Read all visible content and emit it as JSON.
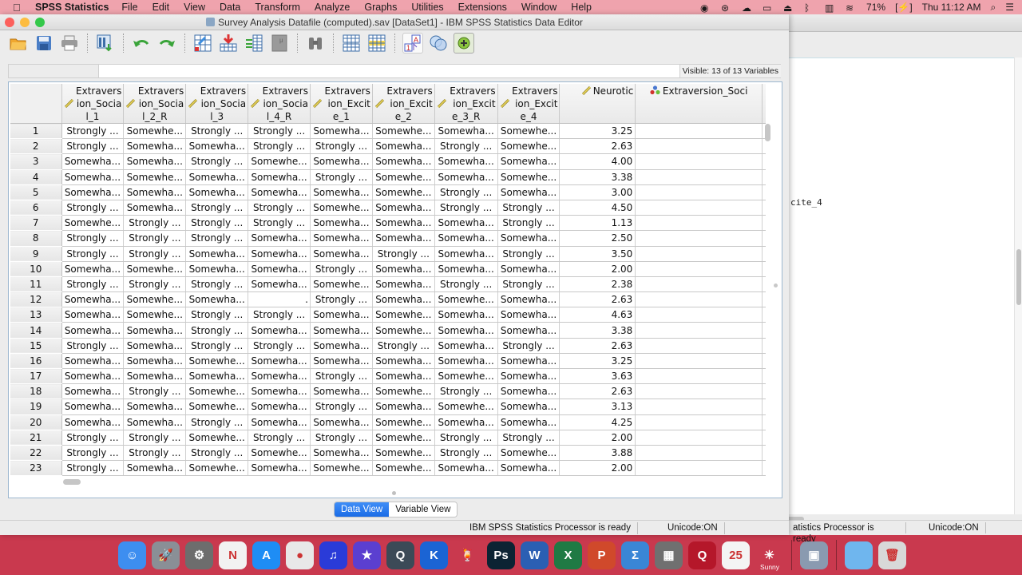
{
  "menubar": {
    "app_name": "SPSS Statistics",
    "items": [
      "File",
      "Edit",
      "View",
      "Data",
      "Transform",
      "Analyze",
      "Graphs",
      "Utilities",
      "Extensions",
      "Window",
      "Help"
    ],
    "battery": "71%",
    "clock": "Thu 11:12 AM"
  },
  "window": {
    "title": "Survey Analysis Datafile (computed).sav [DataSet1] - IBM SPSS Statistics Data Editor"
  },
  "toolbar": {
    "buttons": [
      "open-data",
      "save",
      "print",
      "recall-dialog",
      "undo",
      "redo",
      "go-to-case",
      "go-to-variable",
      "variables",
      "run-descriptive",
      "find",
      "insert-cases",
      "split-file",
      "value-labels",
      "use-variable-sets",
      "show-all-variables",
      "spelling"
    ]
  },
  "cellbar": {
    "visible_count": "Visible: 13 of 13 Variables"
  },
  "grid": {
    "columns": [
      {
        "lines": [
          "Extravers",
          "ion_Socia",
          "l_1"
        ],
        "type": "scale"
      },
      {
        "lines": [
          "Extravers",
          "ion_Socia",
          "l_2_R"
        ],
        "type": "scale"
      },
      {
        "lines": [
          "Extravers",
          "ion_Socia",
          "l_3"
        ],
        "type": "scale"
      },
      {
        "lines": [
          "Extravers",
          "ion_Socia",
          "l_4_R"
        ],
        "type": "scale"
      },
      {
        "lines": [
          "Extravers",
          "ion_Excit",
          "e_1"
        ],
        "type": "scale"
      },
      {
        "lines": [
          "Extravers",
          "ion_Excit",
          "e_2"
        ],
        "type": "scale"
      },
      {
        "lines": [
          "Extravers",
          "ion_Excit",
          "e_3_R"
        ],
        "type": "scale"
      },
      {
        "lines": [
          "Extravers",
          "ion_Excit",
          "e_4"
        ],
        "type": "scale"
      },
      {
        "lines": [
          "Neurotic"
        ],
        "type": "scale"
      },
      {
        "lines": [
          "Extraversion_Soci"
        ],
        "type": "nominal"
      }
    ],
    "rows": [
      {
        "n": "1",
        "c": [
          "Strongly ...",
          "Somewhe...",
          "Strongly ...",
          "Strongly ...",
          "Somewha...",
          "Somewhe...",
          "Somewha...",
          "Somewhe...",
          "3.25",
          ""
        ]
      },
      {
        "n": "2",
        "c": [
          "Strongly ...",
          "Somewha...",
          "Somewha...",
          "Strongly ...",
          "Strongly ...",
          "Somewha...",
          "Strongly ...",
          "Somewhe...",
          "2.63",
          ""
        ]
      },
      {
        "n": "3",
        "c": [
          "Somewha...",
          "Somewha...",
          "Strongly ...",
          "Somewhe...",
          "Somewha...",
          "Somewha...",
          "Somewha...",
          "Somewha...",
          "4.00",
          ""
        ]
      },
      {
        "n": "4",
        "c": [
          "Somewha...",
          "Somewhe...",
          "Somewha...",
          "Somewha...",
          "Strongly ...",
          "Somewhe...",
          "Somewha...",
          "Somewhe...",
          "3.38",
          ""
        ]
      },
      {
        "n": "5",
        "c": [
          "Somewha...",
          "Somewha...",
          "Somewha...",
          "Somewha...",
          "Somewha...",
          "Somewhe...",
          "Strongly ...",
          "Somewha...",
          "3.00",
          ""
        ]
      },
      {
        "n": "6",
        "c": [
          "Strongly ...",
          "Somewha...",
          "Strongly ...",
          "Strongly ...",
          "Somewhe...",
          "Somewha...",
          "Strongly ...",
          "Strongly ...",
          "4.50",
          ""
        ]
      },
      {
        "n": "7",
        "c": [
          "Somewhe...",
          "Strongly ...",
          "Strongly ...",
          "Strongly ...",
          "Somewha...",
          "Somewha...",
          "Somewha...",
          "Strongly ...",
          "1.13",
          ""
        ]
      },
      {
        "n": "8",
        "c": [
          "Strongly ...",
          "Strongly ...",
          "Strongly ...",
          "Somewha...",
          "Somewha...",
          "Somewha...",
          "Somewha...",
          "Somewha...",
          "2.50",
          ""
        ]
      },
      {
        "n": "9",
        "c": [
          "Strongly ...",
          "Strongly ...",
          "Somewha...",
          "Somewha...",
          "Somewha...",
          "Strongly ...",
          "Somewha...",
          "Strongly ...",
          "3.50",
          ""
        ]
      },
      {
        "n": "10",
        "c": [
          "Somewha...",
          "Somewhe...",
          "Somewha...",
          "Somewha...",
          "Strongly ...",
          "Somewha...",
          "Somewha...",
          "Somewha...",
          "2.00",
          ""
        ]
      },
      {
        "n": "11",
        "c": [
          "Strongly ...",
          "Strongly ...",
          "Strongly ...",
          "Somewha...",
          "Somewhe...",
          "Somewha...",
          "Strongly ...",
          "Strongly ...",
          "2.38",
          ""
        ]
      },
      {
        "n": "12",
        "c": [
          "Somewha...",
          "Somewhe...",
          "Somewha...",
          ".",
          "Strongly ...",
          "Somewha...",
          "Somewhe...",
          "Somewha...",
          "2.63",
          ""
        ]
      },
      {
        "n": "13",
        "c": [
          "Somewha...",
          "Somewhe...",
          "Strongly ...",
          "Strongly ...",
          "Somewha...",
          "Somewhe...",
          "Somewha...",
          "Somewha...",
          "4.63",
          ""
        ]
      },
      {
        "n": "14",
        "c": [
          "Somewha...",
          "Somewha...",
          "Strongly ...",
          "Somewha...",
          "Somewha...",
          "Somewhe...",
          "Somewha...",
          "Somewha...",
          "3.38",
          ""
        ]
      },
      {
        "n": "15",
        "c": [
          "Strongly ...",
          "Somewha...",
          "Strongly ...",
          "Strongly ...",
          "Somewha...",
          "Strongly ...",
          "Somewha...",
          "Strongly ...",
          "2.63",
          ""
        ]
      },
      {
        "n": "16",
        "c": [
          "Somewha...",
          "Somewha...",
          "Somewhe...",
          "Somewha...",
          "Somewha...",
          "Somewha...",
          "Somewha...",
          "Somewha...",
          "3.25",
          ""
        ]
      },
      {
        "n": "17",
        "c": [
          "Somewha...",
          "Somewha...",
          "Somewha...",
          "Somewha...",
          "Strongly ...",
          "Somewha...",
          "Somewhe...",
          "Somewha...",
          "3.63",
          ""
        ]
      },
      {
        "n": "18",
        "c": [
          "Somewha...",
          "Strongly ...",
          "Somewhe...",
          "Somewha...",
          "Somewha...",
          "Somewhe...",
          "Strongly ...",
          "Somewha...",
          "2.63",
          ""
        ]
      },
      {
        "n": "19",
        "c": [
          "Somewha...",
          "Somewha...",
          "Somewhe...",
          "Somewha...",
          "Strongly ...",
          "Somewha...",
          "Somewhe...",
          "Somewha...",
          "3.13",
          ""
        ]
      },
      {
        "n": "20",
        "c": [
          "Somewha...",
          "Somewha...",
          "Strongly ...",
          "Somewha...",
          "Somewha...",
          "Somewhe...",
          "Somewha...",
          "Somewha...",
          "4.25",
          ""
        ]
      },
      {
        "n": "21",
        "c": [
          "Strongly ...",
          "Strongly ...",
          "Somewhe...",
          "Strongly ...",
          "Strongly ...",
          "Somewhe...",
          "Strongly ...",
          "Strongly ...",
          "2.00",
          ""
        ]
      },
      {
        "n": "22",
        "c": [
          "Strongly ...",
          "Strongly ...",
          "Strongly ...",
          "Somewhe...",
          "Somewha...",
          "Somewhe...",
          "Strongly ...",
          "Somewhe...",
          "3.88",
          ""
        ]
      },
      {
        "n": "23",
        "c": [
          "Strongly ...",
          "Somewha...",
          "Somewhe...",
          "Somewha...",
          "Somewhe...",
          "Somewhe...",
          "Somewha...",
          "Somewha...",
          "2.00",
          ""
        ]
      }
    ]
  },
  "tabs": {
    "data_view": "Data View",
    "variable_view": "Variable View",
    "active": "data_view"
  },
  "status": {
    "processor": "IBM SPSS Statistics Processor is ready",
    "unicode": "Unicode:ON"
  },
  "background_window": {
    "partial_text": "cite_4",
    "status_processor": "atistics Processor is ready",
    "status_unicode": "Unicode:ON"
  },
  "dock": {
    "apps": [
      {
        "name": "finder",
        "label": "☺",
        "color": "#3d8ef0"
      },
      {
        "name": "launchpad",
        "label": "🚀",
        "color": "#8a8f96"
      },
      {
        "name": "system-preferences",
        "label": "⚙",
        "color": "#6d6d6d"
      },
      {
        "name": "news",
        "label": "N",
        "color": "#f2f2f2"
      },
      {
        "name": "app-store",
        "label": "A",
        "color": "#1e8df5"
      },
      {
        "name": "chrome",
        "label": "●",
        "color": "#e8e8e8"
      },
      {
        "name": "audacity",
        "label": "♫",
        "color": "#2a3bd8"
      },
      {
        "name": "imovie",
        "label": "★",
        "color": "#5b3fd0"
      },
      {
        "name": "quicktime",
        "label": "Q",
        "color": "#3c4a57"
      },
      {
        "name": "downloader",
        "label": "K",
        "color": "#1b64d4"
      },
      {
        "name": "cocktail",
        "label": "🍹",
        "color": "#c9394e"
      },
      {
        "name": "photoshop",
        "label": "Ps",
        "color": "#0c2333"
      },
      {
        "name": "word",
        "label": "W",
        "color": "#2b5fb3"
      },
      {
        "name": "excel",
        "label": "X",
        "color": "#1f7a44"
      },
      {
        "name": "powerpoint",
        "label": "P",
        "color": "#d0492b"
      },
      {
        "name": "spss-calc",
        "label": "Σ",
        "color": "#3a86d6"
      },
      {
        "name": "calculator",
        "label": "▦",
        "color": "#707070"
      },
      {
        "name": "quora",
        "label": "Q",
        "color": "#b5172a"
      },
      {
        "name": "calendar",
        "label": "25",
        "color": "#f4f4f4"
      },
      {
        "name": "weather",
        "label": "☀",
        "color": "#c9394e",
        "sublabel": "Sunny"
      }
    ],
    "after_sep": [
      {
        "name": "preview",
        "label": "▣",
        "color": "#8a9ab0"
      }
    ],
    "after_sep2": [
      {
        "name": "downloads-folder",
        "label": "",
        "color": "#6fb6ee"
      },
      {
        "name": "trash",
        "label": "🗑",
        "color": "#d8d8d8"
      }
    ]
  }
}
